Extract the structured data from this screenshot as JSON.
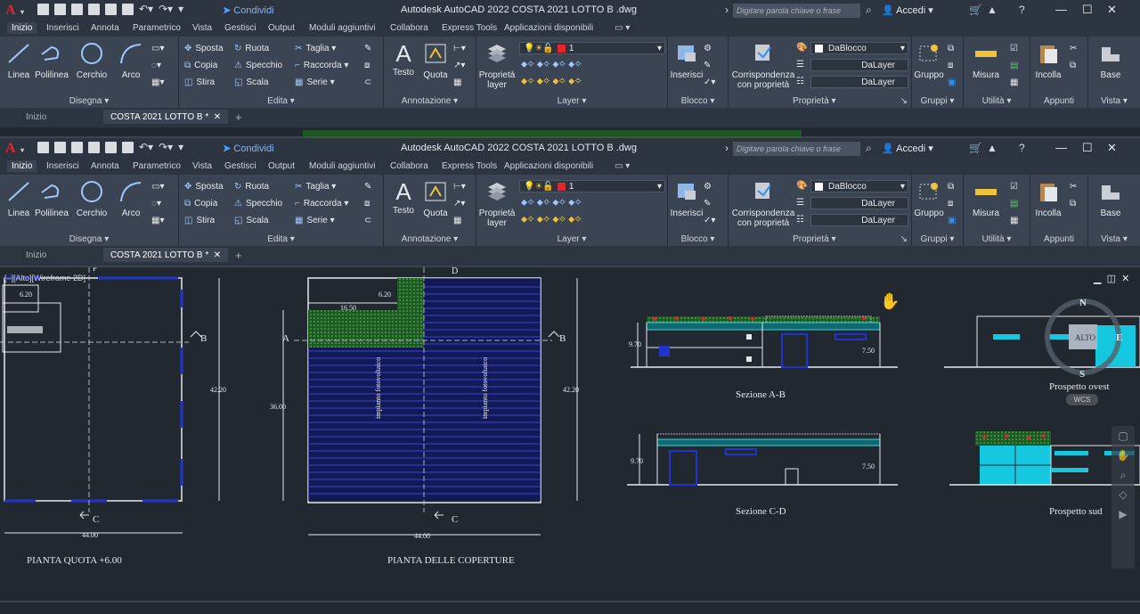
{
  "app": {
    "title": "Autodesk AutoCAD 2022    COSTA 2021 LOTTO B .dwg",
    "share_label": "Condividi",
    "search_placeholder": "Digitare parola chiave o frase",
    "user_label": "Accedi",
    "window_controls": [
      "—",
      "☐",
      "✕"
    ]
  },
  "ribbon": {
    "tabs": [
      "Inizio",
      "Inserisci",
      "Annota",
      "Parametrico",
      "Vista",
      "Gestisci",
      "Output",
      "Moduli aggiuntivi",
      "Collabora",
      "Express Tools",
      "Applicazioni disponibili"
    ],
    "active_tab": "Inizio",
    "panels": {
      "disegna": {
        "label": "Disegna",
        "tools": [
          "Linea",
          "Polilinea",
          "Cerchio",
          "Arco"
        ]
      },
      "edita": {
        "label": "Edita",
        "tools": [
          "Sposta",
          "Ruota",
          "Taglia",
          "Copia",
          "Specchio",
          "Raccorda",
          "Stira",
          "Scala",
          "Serie"
        ]
      },
      "annotazione": {
        "label": "Annotazione",
        "tools": [
          "Testo",
          "Quota"
        ]
      },
      "layer": {
        "label": "Layer",
        "tool": "Proprietà layer",
        "tool_line1": "Proprietà",
        "tool_line2": "layer",
        "current_layer": "1"
      },
      "blocco": {
        "label": "Blocco",
        "tool": "Inserisci"
      },
      "proprieta": {
        "label": "Proprietà",
        "tool_line1": "Corrispondenza",
        "tool_line2": "con proprietà",
        "color": "DaBlocco",
        "linetype": "DaLayer",
        "lineweight": "DaLayer"
      },
      "gruppi": {
        "label": "Gruppi",
        "tool": "Gruppo"
      },
      "utilita": {
        "label": "Utilità",
        "tool": "Misura"
      },
      "appunti": {
        "label": "Appunti",
        "tool": "Incolla"
      },
      "vista": {
        "label": "Vista",
        "tool": "Base"
      }
    }
  },
  "doc_tabs": {
    "start": "Inizio",
    "active": "COSTA 2021 LOTTO B *",
    "add": "+"
  },
  "viewport": {
    "label": "[–][Alto][Wireframe 2D]",
    "viewcube_top": "ALTO",
    "compass_n": "N",
    "compass_s": "S",
    "compass_e": "E",
    "wcs": "WCS"
  },
  "drawing": {
    "plan1_title": "PIANTA QUOTA +6.00",
    "plan2_title": "PIANTA DELLE COPERTURE",
    "section_ab": "Sezione A-B",
    "section_cd": "Sezione C-D",
    "prospetto_ovest": "Prospetto ovest",
    "prospetto_sud": "Prospetto sud",
    "dim_44": "44.00",
    "dim_42_20": "42.20",
    "dim_36": "36.00",
    "dim_16_50": "16.50",
    "dim_6_20": "6.20",
    "dim_9_70": "9.70",
    "dim_7_50": "7.50",
    "pv_label": "impianto fotovoltaico",
    "mark_a": "A",
    "mark_b": "B",
    "mark_c": "C",
    "mark_d": "D",
    "mark_p": "P"
  },
  "colors": {
    "ribbon_bg": "#3b4453",
    "canvas_bg": "#212830",
    "accent": "#2f8ef4",
    "layer_red": "#e2262a"
  }
}
